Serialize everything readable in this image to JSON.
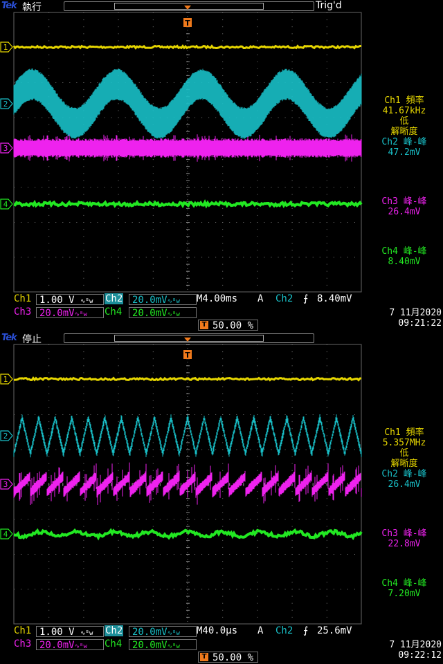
{
  "scopes": [
    {
      "brand": "Tek",
      "status": "執行",
      "trig_status": "Trig'd",
      "ch_markers": [
        "1",
        "2",
        "3",
        "4"
      ],
      "trigger_marker": "T",
      "side": {
        "ch1_label": "Ch1 頻率",
        "ch1_value": "41.67kHz",
        "ch1_note1": "低",
        "ch1_note2": "解晰度",
        "ch2_label": "Ch2 峰-峰",
        "ch2_value": "47.2mV",
        "ch3_label": "Ch3 峰-峰",
        "ch3_value": "26.4mV",
        "ch4_label": "Ch4 峰-峰",
        "ch4_value": "8.40mV"
      },
      "bottom": {
        "ch1": "Ch1",
        "ch1_scale": "1.00 V",
        "ch2": "Ch2",
        "ch2_scale": "20.0mV",
        "ch3": "Ch3",
        "ch3_scale": "20.0mV",
        "ch4": "Ch4",
        "ch4_scale": "20.0mV",
        "timebase": "M4.00ms",
        "acq": "A",
        "trig_src": "Ch2",
        "trig_level": "8.40mV",
        "trig_pos": "50.00 %",
        "date": "7 11月2020",
        "time": "09:21:22"
      },
      "waves": {
        "ch2_cycles": 4.1,
        "ch3_cycles": 0,
        "ch2_noise": "high"
      }
    },
    {
      "brand": "Tek",
      "status": "停止",
      "trig_status": "",
      "ch_markers": [
        "1",
        "2",
        "3",
        "4"
      ],
      "trigger_marker": "T",
      "side": {
        "ch1_label": "Ch1 頻率",
        "ch1_value": "5.357MHz",
        "ch1_note1": "低",
        "ch1_note2": "解晰度",
        "ch2_label": "Ch2 峰-峰",
        "ch2_value": "26.4mV",
        "ch3_label": "Ch3 峰-峰",
        "ch3_value": "22.8mV",
        "ch4_label": "Ch4 峰-峰",
        "ch4_value": "7.20mV"
      },
      "bottom": {
        "ch1": "Ch1",
        "ch1_scale": "1.00 V",
        "ch2": "Ch2",
        "ch2_scale": "20.0mV",
        "ch3": "Ch3",
        "ch3_scale": "20.0mV",
        "ch4": "Ch4",
        "ch4_scale": "20.0mV",
        "timebase": "M40.0µs",
        "acq": "A",
        "trig_src": "Ch2",
        "trig_level": "25.6mV",
        "trig_pos": "50.00 %",
        "date": "7 11月2020",
        "time": "09:22:12"
      },
      "waves": {
        "ch2_cycles": 21,
        "ch3_cycles": 21,
        "ch2_noise": "low"
      }
    }
  ],
  "colors": {
    "ch1": "#e6d600",
    "ch2": "#19c0c8",
    "ch3": "#ee22ee",
    "ch4": "#22e822",
    "trigger": "#f07a1c",
    "brand": "#2a4fd6"
  }
}
